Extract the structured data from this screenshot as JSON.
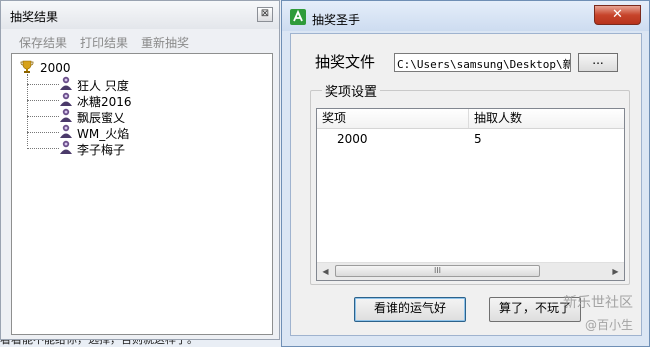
{
  "background": {
    "bottom_text": "看看能不能给你，选择，否则就这样了。"
  },
  "results_window": {
    "title": "抽奖结果",
    "close_glyph": "⊠",
    "toolbar": {
      "save": "保存结果",
      "print": "打印结果",
      "redraw": "重新抽奖"
    },
    "tree": {
      "root_label": "2000",
      "items": [
        "狂人 只度",
        "冰糖2016",
        "飘辰蜜乂",
        "WM_火焰",
        "李子梅子"
      ]
    }
  },
  "main_window": {
    "title": "抽奖圣手",
    "close_glyph": "✕",
    "file_label": "抽奖文件",
    "file_path": "C:\\Users\\samsung\\Desktop\\新建",
    "browse_label": "...",
    "group_title": "奖项设置",
    "columns": [
      "奖项",
      "抽取人数"
    ],
    "rows": [
      {
        "prize": "2000",
        "count": "5"
      }
    ],
    "scroll_left": "◀",
    "scroll_right": "▶",
    "scroll_grip": "III",
    "lucky_button": "看谁的运气好",
    "quit_button": "算了，不玩了"
  },
  "watermark": {
    "line1": "新乐世社区",
    "line2": "@百小生"
  },
  "colors": {
    "accent": "#2c628b",
    "close_red": "#c7442b",
    "titlebar": "#cddcf0"
  }
}
